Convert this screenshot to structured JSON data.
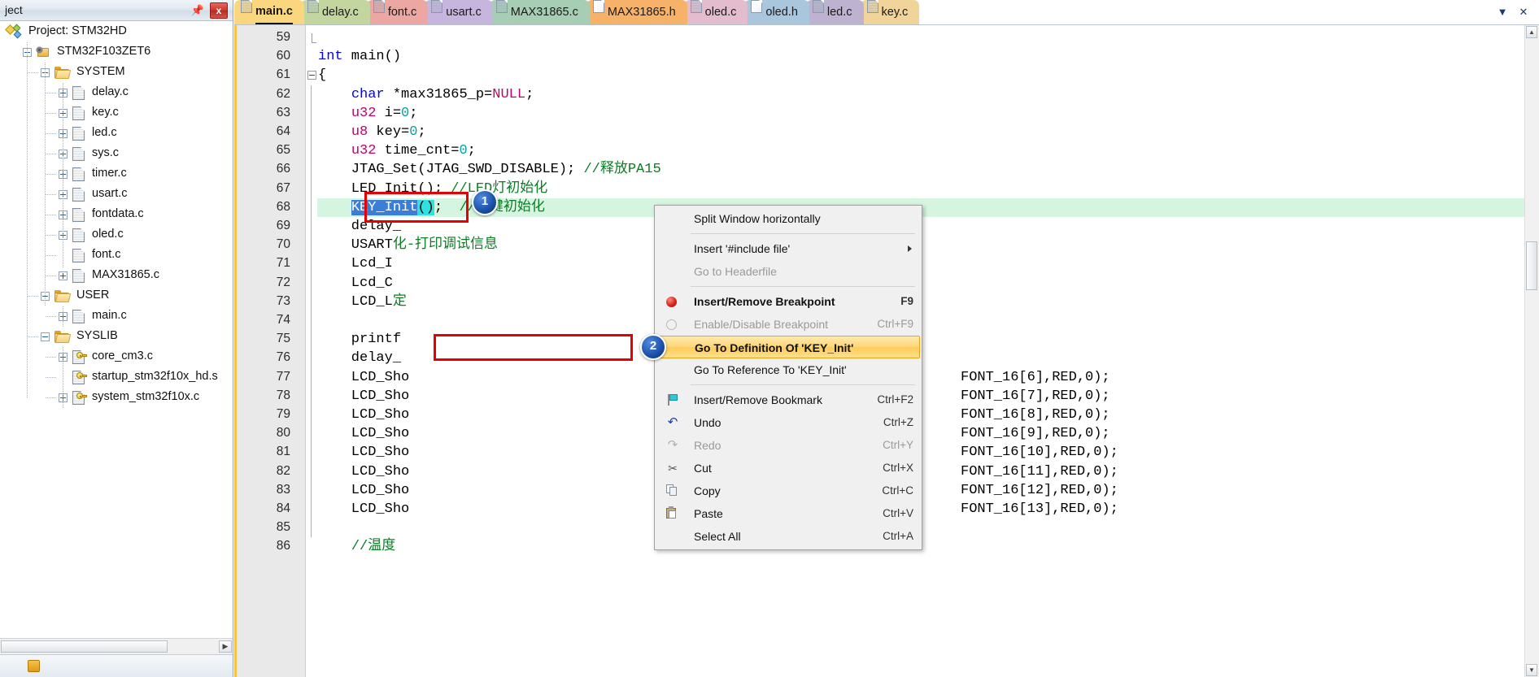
{
  "project_panel": {
    "title": "ject",
    "pin_icon": "pin-icon",
    "close_label": "x",
    "tree": [
      {
        "label": "Project: STM32HD",
        "depth": 0,
        "icon": "project-icon",
        "expander": ""
      },
      {
        "label": "STM32F103ZET6",
        "depth": 1,
        "icon": "device-icon",
        "expander": "minus"
      },
      {
        "label": "SYSTEM",
        "depth": 2,
        "icon": "folder-icon",
        "expander": "minus"
      },
      {
        "label": "delay.c",
        "depth": 3,
        "icon": "c-file-icon",
        "expander": "plus"
      },
      {
        "label": "key.c",
        "depth": 3,
        "icon": "c-file-icon",
        "expander": "plus"
      },
      {
        "label": "led.c",
        "depth": 3,
        "icon": "c-file-icon",
        "expander": "plus"
      },
      {
        "label": "sys.c",
        "depth": 3,
        "icon": "c-file-icon",
        "expander": "plus"
      },
      {
        "label": "timer.c",
        "depth": 3,
        "icon": "c-file-icon",
        "expander": "plus"
      },
      {
        "label": "usart.c",
        "depth": 3,
        "icon": "c-file-icon",
        "expander": "plus"
      },
      {
        "label": "fontdata.c",
        "depth": 3,
        "icon": "c-file-icon",
        "expander": "plus"
      },
      {
        "label": "oled.c",
        "depth": 3,
        "icon": "c-file-icon",
        "expander": "plus"
      },
      {
        "label": "font.c",
        "depth": 3,
        "icon": "c-file-icon",
        "expander": ""
      },
      {
        "label": "MAX31865.c",
        "depth": 3,
        "icon": "c-file-icon",
        "expander": "plus"
      },
      {
        "label": "USER",
        "depth": 2,
        "icon": "folder-icon",
        "expander": "minus"
      },
      {
        "label": "main.c",
        "depth": 3,
        "icon": "c-file-icon",
        "expander": "plus"
      },
      {
        "label": "SYSLIB",
        "depth": 2,
        "icon": "folder-icon",
        "expander": "minus"
      },
      {
        "label": "core_cm3.c",
        "depth": 3,
        "icon": "c-file-key-icon",
        "expander": "plus"
      },
      {
        "label": "startup_stm32f10x_hd.s",
        "depth": 3,
        "icon": "c-file-key-icon",
        "expander": ""
      },
      {
        "label": "system_stm32f10x.c",
        "depth": 3,
        "icon": "c-file-key-icon",
        "expander": "plus"
      }
    ],
    "hscroll_left_arrow": "◀",
    "hscroll_right_arrow": "▶"
  },
  "tabbar": {
    "tabs": [
      {
        "label": "main.c",
        "color": "#fad77f",
        "active": true,
        "icon_plain": false
      },
      {
        "label": "delay.c",
        "color": "#c4d6a0",
        "active": false,
        "icon_plain": false
      },
      {
        "label": "font.c",
        "color": "#eda7a2",
        "active": false,
        "icon_plain": false
      },
      {
        "label": "usart.c",
        "color": "#c6b5dd",
        "active": false,
        "icon_plain": false
      },
      {
        "label": "MAX31865.c",
        "color": "#a8cdb5",
        "active": false,
        "icon_plain": false
      },
      {
        "label": "MAX31865.h",
        "color": "#f7b26a",
        "active": false,
        "icon_plain": true
      },
      {
        "label": "oled.c",
        "color": "#e3bcce",
        "active": false,
        "icon_plain": false
      },
      {
        "label": "oled.h",
        "color": "#a9c6dd",
        "active": false,
        "icon_plain": true
      },
      {
        "label": "led.c",
        "color": "#bdb3d0",
        "active": false,
        "icon_plain": false
      },
      {
        "label": "key.c",
        "color": "#f0d49a",
        "active": false,
        "icon_plain": false
      }
    ],
    "chevron_down": "▼",
    "close": "✕"
  },
  "code": {
    "first_line": 59,
    "lines": [
      {
        "n": 59,
        "segments": [
          {
            "t": "",
            "c": ""
          }
        ]
      },
      {
        "n": 60,
        "segments": [
          {
            "t": "int",
            "c": "kw"
          },
          {
            "t": " main()",
            "c": ""
          }
        ]
      },
      {
        "n": 61,
        "segments": [
          {
            "t": "{",
            "c": ""
          }
        ]
      },
      {
        "n": 62,
        "segments": [
          {
            "t": "    ",
            "c": ""
          },
          {
            "t": "char",
            "c": "kw"
          },
          {
            "t": " *max31865_p=",
            "c": ""
          },
          {
            "t": "NULL",
            "c": "mac"
          },
          {
            "t": ";",
            "c": ""
          }
        ]
      },
      {
        "n": 63,
        "segments": [
          {
            "t": "    ",
            "c": ""
          },
          {
            "t": "u32",
            "c": "typ"
          },
          {
            "t": " i=",
            "c": ""
          },
          {
            "t": "0",
            "c": "num"
          },
          {
            "t": ";",
            "c": ""
          }
        ]
      },
      {
        "n": 64,
        "segments": [
          {
            "t": "    ",
            "c": ""
          },
          {
            "t": "u8",
            "c": "typ"
          },
          {
            "t": " key=",
            "c": ""
          },
          {
            "t": "0",
            "c": "num"
          },
          {
            "t": ";",
            "c": ""
          }
        ]
      },
      {
        "n": 65,
        "segments": [
          {
            "t": "    ",
            "c": ""
          },
          {
            "t": "u32",
            "c": "typ"
          },
          {
            "t": " time_cnt=",
            "c": ""
          },
          {
            "t": "0",
            "c": "num"
          },
          {
            "t": ";",
            "c": ""
          }
        ]
      },
      {
        "n": 66,
        "segments": [
          {
            "t": "    JTAG_Set(JTAG_SWD_DISABLE); ",
            "c": ""
          },
          {
            "t": "//释放PA15",
            "c": "cmt"
          }
        ]
      },
      {
        "n": 67,
        "segments": [
          {
            "t": "    LED_Init(); ",
            "c": ""
          },
          {
            "t": "//LED灯初始化",
            "c": "cmt"
          }
        ]
      },
      {
        "n": 68,
        "segments": [
          {
            "t": "    ",
            "c": ""
          },
          {
            "t": "KEY_Init",
            "c": "sel"
          },
          {
            "t": "()",
            "c": "caretbox"
          },
          {
            "t": ";  ",
            "c": ""
          },
          {
            "t": "//按键初始化",
            "c": "cmt"
          }
        ]
      },
      {
        "n": 69,
        "segments": [
          {
            "t": "    delay_",
            "c": ""
          }
        ]
      },
      {
        "n": 70,
        "segments": [
          {
            "t": "    USART",
            "c": ""
          },
          {
            "t": "化-打印调试信息",
            "c": "cmt"
          }
        ]
      },
      {
        "n": 71,
        "segments": [
          {
            "t": "    Lcd_I",
            "c": ""
          }
        ]
      },
      {
        "n": 72,
        "segments": [
          {
            "t": "    Lcd_C",
            "c": ""
          }
        ]
      },
      {
        "n": 73,
        "segments": [
          {
            "t": "    LCD_L",
            "c": ""
          },
          {
            "t": "定",
            "c": "cmt"
          }
        ]
      },
      {
        "n": 74,
        "segments": [
          {
            "t": "",
            "c": ""
          }
        ]
      },
      {
        "n": 75,
        "segments": [
          {
            "t": "    printf",
            "c": ""
          }
        ]
      },
      {
        "n": 76,
        "segments": [
          {
            "t": "    delay_",
            "c": ""
          }
        ]
      },
      {
        "n": 77,
        "segments": [
          {
            "t": "    LCD_Sho",
            "c": ""
          },
          {
            "t": "FONT_16[6],RED,0);",
            "c": "tail77"
          }
        ]
      },
      {
        "n": 78,
        "segments": [
          {
            "t": "    LCD_Sho",
            "c": ""
          },
          {
            "t": "FONT_16[7],RED,0);",
            "c": "tail78"
          }
        ]
      },
      {
        "n": 79,
        "segments": [
          {
            "t": "    LCD_Sho",
            "c": ""
          },
          {
            "t": "FONT_16[8],RED,0);",
            "c": "tail79"
          }
        ]
      },
      {
        "n": 80,
        "segments": [
          {
            "t": "    LCD_Sho",
            "c": ""
          },
          {
            "t": "FONT_16[9],RED,0);",
            "c": "tail80"
          }
        ]
      },
      {
        "n": 81,
        "segments": [
          {
            "t": "    LCD_Sho",
            "c": ""
          },
          {
            "t": "FONT_16[10],RED,0);",
            "c": "tail81"
          }
        ]
      },
      {
        "n": 82,
        "segments": [
          {
            "t": "    LCD_Sho",
            "c": ""
          },
          {
            "t": "FONT_16[11],RED,0);",
            "c": "tail82"
          }
        ]
      },
      {
        "n": 83,
        "segments": [
          {
            "t": "    LCD_Sho",
            "c": ""
          },
          {
            "t": "FONT_16[12],RED,0);",
            "c": "tail83"
          }
        ]
      },
      {
        "n": 84,
        "segments": [
          {
            "t": "    LCD_Sho",
            "c": ""
          },
          {
            "t": "FONT_16[13],RED,0);",
            "c": "tail84"
          }
        ]
      },
      {
        "n": 85,
        "segments": [
          {
            "t": "",
            "c": ""
          }
        ]
      },
      {
        "n": 86,
        "segments": [
          {
            "t": "    ",
            "c": ""
          },
          {
            "t": "//温度",
            "c": "cmt"
          }
        ]
      }
    ],
    "right_fragments": [
      {
        "n": 77,
        "text": "FONT_16[6],RED,0);"
      },
      {
        "n": 78,
        "text": "FONT_16[7],RED,0);"
      },
      {
        "n": 79,
        "text": "FONT_16[8],RED,0);"
      },
      {
        "n": 80,
        "text": "FONT_16[9],RED,0);"
      },
      {
        "n": 81,
        "text": "FONT_16[10],RED,0);"
      },
      {
        "n": 82,
        "text": "FONT_16[11],RED,0);"
      },
      {
        "n": 83,
        "text": "FONT_16[12],RED,0);"
      },
      {
        "n": 84,
        "text": "FONT_16[13],RED,0);"
      }
    ]
  },
  "context_menu": {
    "items": [
      {
        "label": "Split Window horizontally",
        "shortcut": "",
        "state": "normal",
        "icon": "",
        "submenu": false
      },
      {
        "sep": true
      },
      {
        "label": "Insert '#include file'",
        "shortcut": "",
        "state": "normal",
        "icon": "",
        "submenu": true
      },
      {
        "label": "Go to Headerfile",
        "shortcut": "",
        "state": "disabled",
        "icon": "",
        "submenu": false
      },
      {
        "sep": true
      },
      {
        "label": "Insert/Remove Breakpoint",
        "shortcut": "F9",
        "state": "bold",
        "icon": "breakpoint-red-dot-icon",
        "submenu": false
      },
      {
        "label": "Enable/Disable Breakpoint",
        "shortcut": "Ctrl+F9",
        "state": "disabled",
        "icon": "breakpoint-hollow-dot-icon",
        "submenu": false
      },
      {
        "label": "Go To Definition Of 'KEY_Init'",
        "shortcut": "",
        "state": "highlight",
        "icon": "",
        "submenu": false
      },
      {
        "label": "Go To Reference To 'KEY_Init'",
        "shortcut": "",
        "state": "normal",
        "icon": "",
        "submenu": false
      },
      {
        "sep": true
      },
      {
        "label": "Insert/Remove Bookmark",
        "shortcut": "Ctrl+F2",
        "state": "normal",
        "icon": "bookmark-flag-icon",
        "submenu": false
      },
      {
        "label": "Undo",
        "shortcut": "Ctrl+Z",
        "state": "normal",
        "icon": "undo-icon",
        "submenu": false
      },
      {
        "label": "Redo",
        "shortcut": "Ctrl+Y",
        "state": "disabled",
        "icon": "redo-icon",
        "submenu": false
      },
      {
        "label": "Cut",
        "shortcut": "Ctrl+X",
        "state": "normal",
        "icon": "cut-icon",
        "submenu": false
      },
      {
        "label": "Copy",
        "shortcut": "Ctrl+C",
        "state": "normal",
        "icon": "copy-icon",
        "submenu": false
      },
      {
        "label": "Paste",
        "shortcut": "Ctrl+V",
        "state": "normal",
        "icon": "paste-icon",
        "submenu": false
      },
      {
        "label": "Select All",
        "shortcut": "Ctrl+A",
        "state": "normal",
        "icon": "",
        "submenu": false
      }
    ]
  },
  "annotations": {
    "badge1": "1",
    "badge2": "2",
    "highlight_color": "#e80000"
  },
  "scrollbars": {
    "up_arrow": "▲",
    "down_arrow": "▼"
  }
}
